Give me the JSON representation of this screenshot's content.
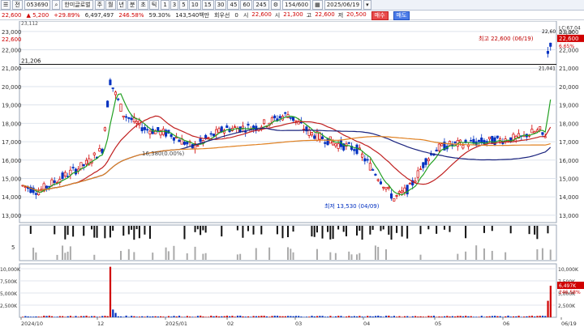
{
  "toolbar": {
    "code": "053690",
    "name": "한미글로벌",
    "period_buttons": [
      "주",
      "월",
      "년",
      "분",
      "초",
      "틱"
    ],
    "minute_buttons": [
      "1",
      "3",
      "5",
      "10",
      "15",
      "30",
      "45",
      "60",
      "245"
    ],
    "count": "154/600",
    "date": "2025/06/19"
  },
  "infobar": {
    "price": "22,600",
    "change": "▲ 5,200",
    "change_pct": "+29.89%",
    "volume": "6,497,497",
    "volume_ratio": "246.58%",
    "turnover_pct": "59.30%",
    "trade_value": "143,540백만",
    "delta_label": "회우선",
    "delta_value": "0",
    "ohlc": [
      {
        "label": "시",
        "value": "22,600"
      },
      {
        "label": "시",
        "value": "21,300"
      },
      {
        "label": "고",
        "value": "22,600"
      },
      {
        "label": "저",
        "value": "20,500"
      }
    ],
    "buy_label": "매수",
    "sell_label": "매도"
  },
  "price_chart": {
    "y_ticks": [
      "23,000",
      "22,000",
      "21,000",
      "20,000",
      "19,000",
      "18,000",
      "17,000",
      "16,000",
      "15,000",
      "14,000",
      "13,000"
    ],
    "hline_label": "21,206",
    "top_left_label": "23,112",
    "high_annotation": "최고 22,600 (06/19)",
    "low_annotation": "최저 13,530 (04/09)",
    "ma_annotation": "16,380(0.00%)",
    "right_tags": {
      "current": "22,600",
      "pct": "6.65%",
      "lc": "LC:67.04",
      "d": "D:0.00",
      "label_21": "21,041",
      "label_2": "22,60"
    }
  },
  "volume_chart": {
    "y_ticks": [
      "10,000K",
      "7,500K",
      "5,000K",
      "2,500K"
    ],
    "right_tags": {
      "volume": "6,497K",
      "pct": "246.58%"
    }
  },
  "signal_chart": {
    "y_tick": "5"
  },
  "x_axis": {
    "labels": [
      "2024/10",
      "12",
      "2025/01",
      "02",
      "03",
      "04",
      "05",
      "06",
      "06/19"
    ]
  },
  "colors": {
    "up": "#d00000",
    "down": "#0030c0",
    "ma5": "#22a022",
    "ma20": "#c02020",
    "ma60": "#1a237e",
    "ma120": "#e08020"
  }
}
